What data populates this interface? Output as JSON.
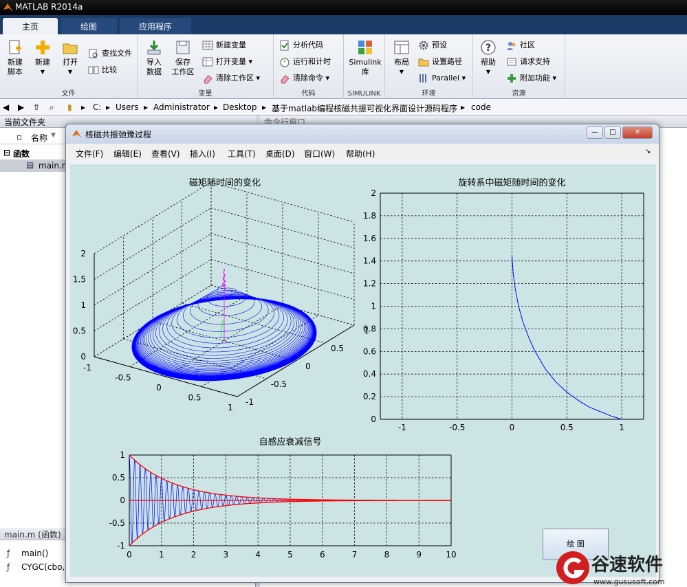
{
  "window": {
    "title": "MATLAB R2014a"
  },
  "ribbon_tabs": [
    {
      "label": "主页"
    },
    {
      "label": "绘图"
    },
    {
      "label": "应用程序"
    }
  ],
  "ribbon": {
    "file": {
      "label": "文件",
      "new_script": "新建\n脚本",
      "new": "新建",
      "open": "打开",
      "find_files": "查找文件",
      "compare": "比较"
    },
    "variable": {
      "label": "变量",
      "import": "导入\n数据",
      "save_ws": "保存\n工作区",
      "new_var": "新建变量",
      "open_var": "打开变量",
      "clear_ws": "清除工作区"
    },
    "code": {
      "label": "代码",
      "analyze": "分析代码",
      "run_time": "运行和计时",
      "clear_cmd": "清除命令"
    },
    "simulink": {
      "label": "SIMULINK",
      "lib": "Simulink\n库"
    },
    "env": {
      "label": "环境",
      "layout": "布局",
      "prefs": "预设",
      "set_path": "设置路径",
      "parallel": "Parallel"
    },
    "res": {
      "label": "资源",
      "help": "帮助",
      "community": "社区",
      "request": "请求支持",
      "addons": "附加功能"
    }
  },
  "address": {
    "parts": [
      "C:",
      "Users",
      "Administrator",
      "Desktop",
      "基于matlab编程核磁共振可视化界面设计源码程序",
      "code"
    ]
  },
  "left_panel": {
    "header": "当前文件夹",
    "col_name": "名称",
    "group": "函数",
    "file": "main.m",
    "detail_header": "main.m (函数)",
    "functions": [
      "main()",
      "CYGC(cbo,"
    ]
  },
  "cmd_header": "命令行窗口",
  "figure": {
    "title": "核磁共振弛豫过程",
    "menus": [
      "文件(F)",
      "编辑(E)",
      "查看(V)",
      "插入(I)",
      "工具(T)",
      "桌面(D)",
      "窗口(W)",
      "帮助(H)"
    ],
    "draw_button": "绘 图"
  },
  "chart_data": [
    {
      "type": "line",
      "title": "磁矩随时间的变化",
      "projection": "3d",
      "x_ticks": [
        "-1",
        "-0.5",
        "0",
        "0.5",
        "1"
      ],
      "y_ticks": [
        "-1",
        "-0.5",
        "0",
        "0.5",
        "1"
      ],
      "z_ticks": [
        "0",
        "0.5",
        "1",
        "1.5",
        "2"
      ],
      "grid": true,
      "colors": {
        "spiral": "#0000ff",
        "axis_line": "#ff00ff",
        "trace": "#00ff00"
      }
    },
    {
      "type": "line",
      "title": "旋转系中磁矩随时间的变化",
      "xlim": [
        -1.2,
        1.2
      ],
      "ylim": [
        0,
        2
      ],
      "x_ticks": [
        "-1",
        "-0.5",
        "0",
        "0.5",
        "1"
      ],
      "y_ticks": [
        "0",
        "0.2",
        "0.4",
        "0.6",
        "0.8",
        "1",
        "1.2",
        "1.4",
        "1.6",
        "1.8",
        "2"
      ],
      "grid": true,
      "series": [
        {
          "color": "#0000ff",
          "x": [
            0,
            0.01,
            0.03,
            0.06,
            0.1,
            0.15,
            0.2,
            0.3,
            0.4,
            0.5,
            0.6,
            0.7,
            0.8,
            0.9,
            1.0
          ],
          "y": [
            1.45,
            1.3,
            1.15,
            1.0,
            0.86,
            0.73,
            0.62,
            0.45,
            0.33,
            0.24,
            0.17,
            0.11,
            0.07,
            0.03,
            0.0
          ]
        }
      ]
    },
    {
      "type": "line",
      "title": "自感应衰减信号",
      "xlim": [
        0,
        10
      ],
      "ylim": [
        -1,
        1
      ],
      "x_ticks": [
        "0",
        "1",
        "2",
        "3",
        "4",
        "5",
        "6",
        "7",
        "8",
        "9",
        "10"
      ],
      "y_ticks": [
        "-1",
        "-0.5",
        "0",
        "0.5",
        "1"
      ],
      "grid": true,
      "decay": 0.72,
      "freq_hz": 6,
      "signal_end": 8.3,
      "colors": {
        "signal": "#0000ff",
        "envelope": "#ff0000"
      }
    }
  ]
}
